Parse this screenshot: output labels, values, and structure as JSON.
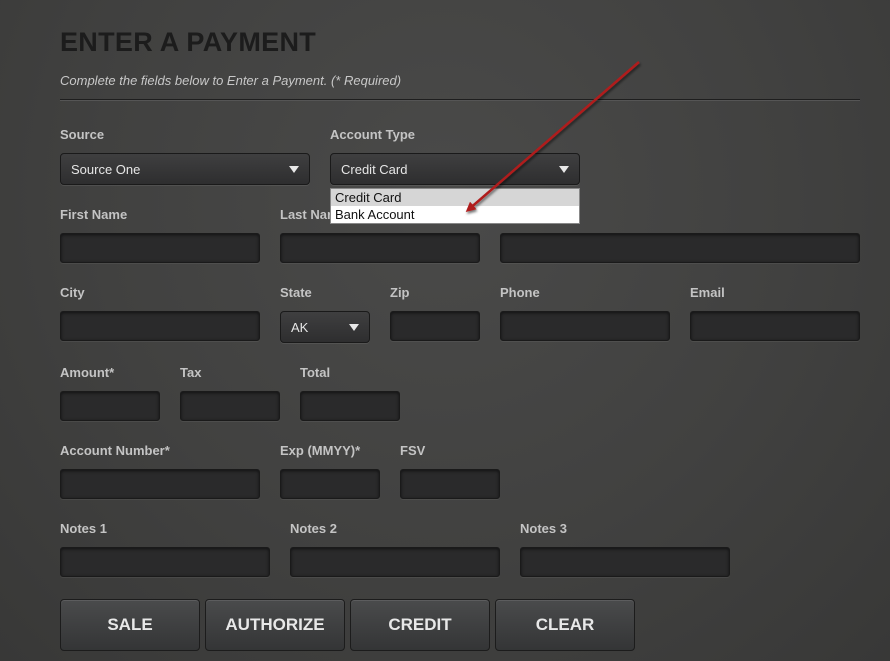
{
  "header": {
    "title": "ENTER A PAYMENT",
    "subtitle": "Complete the fields below to Enter a Payment. (* Required)"
  },
  "source": {
    "label": "Source",
    "value": "Source One"
  },
  "account_type": {
    "label": "Account Type",
    "value": "Credit Card",
    "options": [
      "Credit Card",
      "Bank Account"
    ]
  },
  "fields": {
    "first_name": "First Name",
    "last_name": "Last Nar",
    "city": "City",
    "state": {
      "label": "State",
      "value": "AK"
    },
    "zip": "Zip",
    "phone": "Phone",
    "email": "Email",
    "amount": "Amount*",
    "tax": "Tax",
    "total": "Total",
    "account_number": "Account Number*",
    "exp": "Exp (MMYY)*",
    "fsv": "FSV",
    "notes1": "Notes 1",
    "notes2": "Notes 2",
    "notes3": "Notes 3"
  },
  "buttons": {
    "sale": "SALE",
    "authorize": "AUTHORIZE",
    "credit": "CREDIT",
    "clear": "CLEAR"
  },
  "colors": {
    "annotation_arrow": "#b01e1e"
  }
}
